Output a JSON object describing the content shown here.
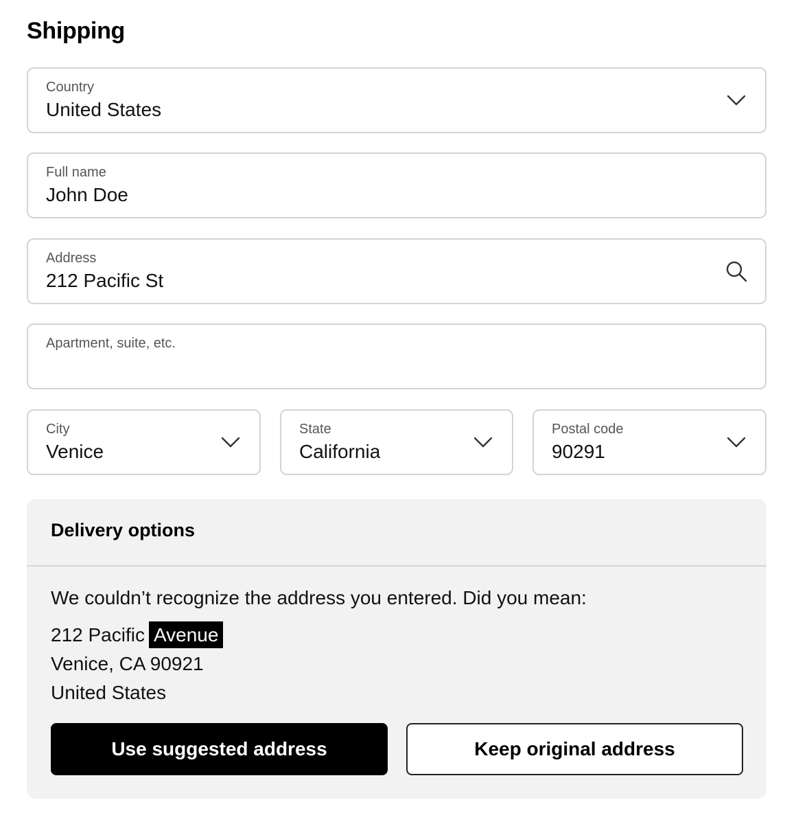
{
  "page": {
    "title": "Shipping"
  },
  "fields": {
    "country": {
      "label": "Country",
      "value": "United States",
      "icon": "chevron-down-icon"
    },
    "full_name": {
      "label": "Full name",
      "value": "John Doe"
    },
    "address": {
      "label": "Address",
      "value": "212 Pacific St",
      "icon": "search-icon"
    },
    "apartment": {
      "label": "Apartment, suite, etc.",
      "value": ""
    },
    "city": {
      "label": "City",
      "value": "Venice",
      "icon": "chevron-down-icon"
    },
    "state": {
      "label": "State",
      "value": "California",
      "icon": "chevron-down-icon"
    },
    "postal_code": {
      "label": "Postal code",
      "value": "90291",
      "icon": "chevron-down-icon"
    }
  },
  "delivery": {
    "header": "Delivery options",
    "message": "We couldn’t recognize the address you entered. Did you mean:",
    "suggested": {
      "line1_prefix": "212 Pacific",
      "line1_highlight": "Avenue",
      "line2": "Venice, CA 90921",
      "line3": "United States"
    },
    "use_suggested_label": "Use suggested address",
    "keep_original_label": "Keep original address"
  },
  "colors": {
    "primary_button": "#000000",
    "field_border": "#d4d4d4",
    "panel_background": "#f2f2f2"
  }
}
